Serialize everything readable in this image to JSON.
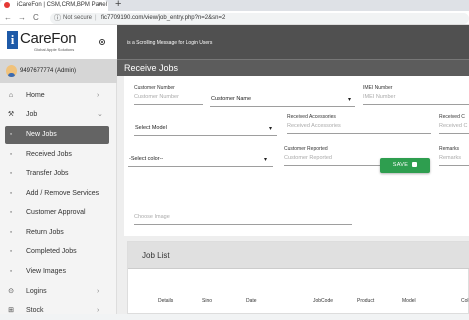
{
  "browser": {
    "tab_title": "iCareFon | CSM,CRM,BPM Panel",
    "tab_close": "×",
    "new_tab": "+",
    "back": "←",
    "forward": "→",
    "reload": "C",
    "security_icon": "ⓘ",
    "security_label": "Not secure",
    "separator": "|",
    "url": "fic7709190.com/view/job_entry.php?n=2&sn=2"
  },
  "logo": {
    "letter": "i",
    "brand": "CareFon",
    "tagline": "Global Apple Solutions"
  },
  "user": {
    "name": "9497677774 (Admin)"
  },
  "sidebar": {
    "items": [
      {
        "icon": "⌂",
        "icon_name": "home-icon",
        "label": "Home",
        "chevron": "›"
      },
      {
        "icon": "⚒",
        "icon_name": "wrench-icon",
        "label": "Job",
        "chevron": "⌄"
      },
      {
        "icon": "◦",
        "icon_name": "bullet-icon",
        "label": "New Jobs",
        "active": true
      },
      {
        "icon": "◦",
        "icon_name": "bullet-icon",
        "label": "Received Jobs"
      },
      {
        "icon": "◦",
        "icon_name": "bullet-icon",
        "label": "Transfer Jobs"
      },
      {
        "icon": "◦",
        "icon_name": "bullet-icon",
        "label": "Add / Remove Services"
      },
      {
        "icon": "◦",
        "icon_name": "bullet-icon",
        "label": "Customer Approval"
      },
      {
        "icon": "◦",
        "icon_name": "bullet-icon",
        "label": "Return Jobs"
      },
      {
        "icon": "◦",
        "icon_name": "bullet-icon",
        "label": "Completed Jobs"
      },
      {
        "icon": "◦",
        "icon_name": "bullet-icon",
        "label": "View Images"
      },
      {
        "icon": "⊙",
        "icon_name": "login-icon",
        "label": "Logins",
        "chevron": "›"
      },
      {
        "icon": "⊞",
        "icon_name": "stock-icon",
        "label": "Stock",
        "chevron": "›"
      }
    ]
  },
  "marquee": {
    "text": "is a Scrolling Message for Login Users"
  },
  "panel": {
    "title": "Receive Jobs"
  },
  "form": {
    "customer_number_label": "Customer Number",
    "customer_number_placeholder": "Customer Number",
    "customer_name_value": "Customer Name",
    "imei_label": "IMEI Number",
    "imei_placeholder": "IMEI Number",
    "model_value": "Select Model",
    "accessories_label": "Received Accessories",
    "accessories_placeholder": "Received Accessories",
    "received_c_label": "Received C",
    "received_c_placeholder": "Received C",
    "color_value": "-Select color--",
    "reported_label": "Customer Reported",
    "reported_placeholder": "Customer Reported",
    "remarks_label": "Remarks",
    "remarks_placeholder": "Remarks",
    "image_placeholder": "Choose Image",
    "save_label": "SAVE",
    "dropdown_caret": "▾"
  },
  "job_list": {
    "title": "Job List",
    "columns": [
      "Details",
      "Sino",
      "Date",
      "JobCode",
      "Product",
      "Model",
      "Col"
    ]
  }
}
